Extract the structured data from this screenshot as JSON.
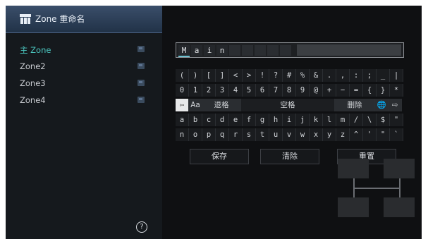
{
  "sidebar": {
    "title": "Zone 重命名",
    "zones": [
      {
        "label": "主 Zone",
        "active": true
      },
      {
        "label": "Zone2",
        "active": false
      },
      {
        "label": "Zone3",
        "active": false
      },
      {
        "label": "Zone4",
        "active": false
      }
    ],
    "help_symbol": "?"
  },
  "name_input": {
    "characters": [
      "M",
      "a",
      "i",
      "n"
    ]
  },
  "keyboard": {
    "row1": [
      "(",
      ")",
      "[",
      "]",
      "<",
      ">",
      "!",
      "?",
      "#",
      "%",
      "&",
      ".",
      ",",
      ":",
      ";",
      "_",
      "|"
    ],
    "row2": [
      "0",
      "1",
      "2",
      "3",
      "4",
      "5",
      "6",
      "7",
      "8",
      "9",
      "@",
      "+",
      "−",
      "=",
      "{",
      "}",
      "*"
    ],
    "row3": {
      "left_arrow": "⇦",
      "case": "Aa",
      "backspace": "退格",
      "space": "空格",
      "delete": "删除",
      "globe": "🌐",
      "right_arrow": "⇨"
    },
    "row4": [
      "a",
      "b",
      "c",
      "d",
      "e",
      "f",
      "g",
      "h",
      "i",
      "j",
      "k",
      "l",
      "m",
      "/",
      "\\",
      "$",
      "\""
    ],
    "row5": [
      "n",
      "o",
      "p",
      "q",
      "r",
      "s",
      "t",
      "u",
      "v",
      "w",
      "x",
      "y",
      "z",
      "^",
      "'",
      "\"",
      "`"
    ]
  },
  "actions": {
    "save": "保存",
    "clear": "清除",
    "reset": "重置"
  },
  "colors": {
    "accent": "#4bc7c0",
    "title_bar": "#2c3f57"
  }
}
